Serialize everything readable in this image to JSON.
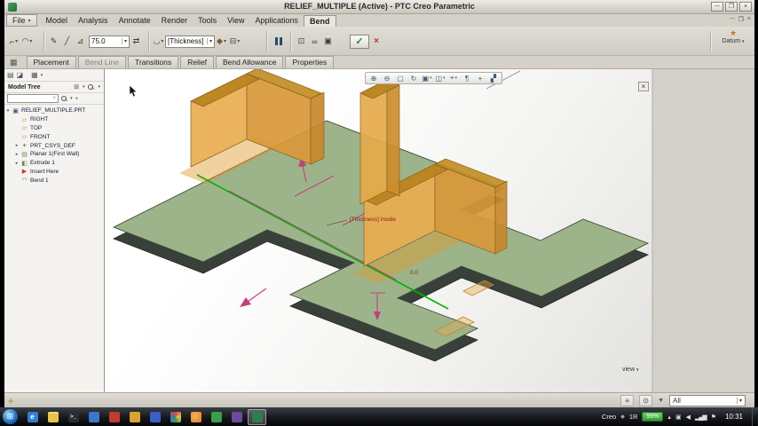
{
  "titlebar": {
    "title": "RELIEF_MULTIPLE (Active) - PTC Creo Parametric"
  },
  "menubar": {
    "items": [
      "File",
      "Model",
      "Analysis",
      "Annotate",
      "Render",
      "Tools",
      "View",
      "Applications",
      "Bend"
    ],
    "active": "Bend"
  },
  "ribbon": {
    "angle_value": "75.0",
    "radius_value": "[Thickness]",
    "datum_label": "Datum"
  },
  "dashboard_tabs": {
    "items": [
      "Placement",
      "Bend Line",
      "Transitions",
      "Relief",
      "Bend Allowance",
      "Properties"
    ]
  },
  "model_tree": {
    "header": "Model Tree",
    "items": [
      {
        "label": "RELIEF_MULTIPLE.PRT",
        "icon": "part-icon",
        "glyph": "▣",
        "expander": "▾"
      },
      {
        "label": "RIGHT",
        "icon": "datum-plane-icon",
        "glyph": "▱",
        "expander": ""
      },
      {
        "label": "TOP",
        "icon": "datum-plane-icon",
        "glyph": "▱",
        "expander": ""
      },
      {
        "label": "FRONT",
        "icon": "datum-plane-icon",
        "glyph": "▱",
        "expander": ""
      },
      {
        "label": "PRT_CSYS_DEF",
        "icon": "csys-icon",
        "glyph": "+",
        "expander": "▸"
      },
      {
        "label": "Planar 1(First Wall)",
        "icon": "wall-icon",
        "glyph": "▤",
        "expander": "▸"
      },
      {
        "label": "Extrude 1",
        "icon": "extrude-icon",
        "glyph": "◧",
        "expander": "▸"
      },
      {
        "label": "Insert Here",
        "icon": "insert-here-icon",
        "glyph": "▶",
        "expander": ""
      },
      {
        "label": "Bend 1",
        "icon": "bend-icon",
        "glyph": "◠",
        "expander": ""
      }
    ]
  },
  "gfx_toolbar": {
    "buttons": [
      {
        "name": "zoom-in-icon",
        "glyph": "⊕"
      },
      {
        "name": "zoom-out-icon",
        "glyph": "⊖"
      },
      {
        "name": "refit-icon",
        "glyph": "▢"
      },
      {
        "name": "repaint-icon",
        "glyph": "↻"
      },
      {
        "name": "display-style-icon",
        "glyph": "▣"
      },
      {
        "name": "saved-views-icon",
        "glyph": "◫"
      },
      {
        "name": "datum-display-icon",
        "glyph": "⌖"
      },
      {
        "name": "annotation-display-icon",
        "glyph": "¶"
      },
      {
        "name": "spin-center-icon",
        "glyph": "+"
      },
      {
        "name": "view-manager-icon",
        "glyph": "▞"
      }
    ]
  },
  "viewport": {
    "thickness_label": "[Thickness] Inside",
    "angle_readout": "0.0",
    "view_dropdown": "view"
  },
  "statusbar": {
    "filter_value": "All"
  },
  "taskbar": {
    "creo_label": "Creo",
    "session_label": "1R",
    "battery": "99%",
    "time": "10:31",
    "icons": [
      {
        "name": "ie-browser-icon",
        "color": "#2f7fd4",
        "glyph": "e"
      },
      {
        "name": "folder-icon",
        "color": "#e8c34a",
        "glyph": ""
      },
      {
        "name": "terminal-icon",
        "color": "#2a2d33",
        "glyph": ">_"
      },
      {
        "name": "media-player-icon",
        "color": "#3a78c9",
        "glyph": ""
      },
      {
        "name": "red-app-icon",
        "color": "#c23b2e",
        "glyph": ""
      },
      {
        "name": "yellow-app-icon",
        "color": "#d9a32e",
        "glyph": ""
      },
      {
        "name": "blue-app-icon",
        "color": "#3a5fc9",
        "glyph": ""
      },
      {
        "name": "chrome-browser-icon",
        "color": "#4a9ad9",
        "glyph": ""
      },
      {
        "name": "firefox-browser-icon",
        "color": "#e07b2e",
        "glyph": ""
      },
      {
        "name": "green-app-icon",
        "color": "#3a9e4a",
        "glyph": ""
      },
      {
        "name": "purple-app-icon",
        "color": "#6a4a9e",
        "glyph": ""
      },
      {
        "name": "creo-app-icon",
        "color": "#2e7d4f",
        "glyph": ""
      }
    ]
  },
  "colors": {
    "plate_green": "#9db48a",
    "plate_edge_dark": "#394039",
    "bend_highlight_orange": "#e9ad4f",
    "bend_line_green": "#00b400",
    "construction_magenta": "#c2407e",
    "annotation_dark_red": "#8b1a1a",
    "confirm_green": "#1e8e2e",
    "cancel_red": "#c03028",
    "battery_green": "#2e9e2e"
  },
  "icons": {
    "dropdown": "▾",
    "window_minimize": "─",
    "window_restore": "❐",
    "window_close": "×",
    "bend_type_1": "⌐",
    "bend_type_2": "◠",
    "sketch": "✎",
    "bend_line_select": "╱",
    "angle": "⊿",
    "flip": "⇄",
    "radius_side": "◡",
    "dim_side": "◆",
    "extra_option": "⊟",
    "preview_wireframe": "⊡",
    "preview_glasses": "∞",
    "preview_shaded": "▣",
    "check": "✓",
    "cancel": "×",
    "datum_star": "★",
    "panel_cascade": "▤",
    "panel_show": "◪",
    "panel_settings": "▦",
    "tree_filter": "⊞",
    "clear": "×",
    "add": "+",
    "funnel": "▼",
    "status_marker": "◈",
    "status_list": "≡",
    "status_select": "⊙",
    "start": "⊞",
    "strip_icon": "▦",
    "tray_hidden": "▴",
    "tray_keyboard": "▣",
    "tray_volume": "◀",
    "tray_network": "▂▄▆",
    "tray_flag": "⚑",
    "tray_diamond": "◆",
    "vp_close": "×"
  }
}
